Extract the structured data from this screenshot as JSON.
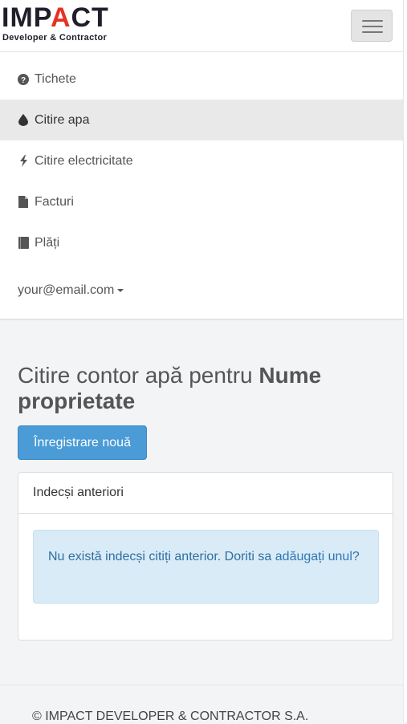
{
  "header": {
    "logo_main_prefix": "IMP",
    "logo_main_accent": "A",
    "logo_main_suffix": "CT",
    "logo_sub": "Developer & Contractor",
    "menu_toggle_icon": "hamburger-icon"
  },
  "menu": {
    "items": [
      {
        "label": "Tichete",
        "icon": "question-circle-icon",
        "active": false
      },
      {
        "label": "Citire apa",
        "icon": "water-drop-icon",
        "active": true
      },
      {
        "label": "Citire electricitate",
        "icon": "lightning-bolt-icon",
        "active": false
      },
      {
        "label": "Facturi",
        "icon": "file-icon",
        "active": false
      },
      {
        "label": "Plăți",
        "icon": "book-icon",
        "active": false
      }
    ],
    "user_email": "your@email.com"
  },
  "main": {
    "title_prefix": "Citire contor apă pentru ",
    "title_bold": "Nume proprietate",
    "new_button_label": "Înregistrare nouă",
    "panel_title": "Indecși anteriori",
    "alert_text": "Nu există indecși citiți anterior. Doriti sa ",
    "alert_link": "adăugați unul",
    "alert_suffix": "?"
  },
  "footer": {
    "text": "© IMPACT DEVELOPER & CONTRACTOR S.A."
  },
  "colors": {
    "accent": "#4a9bd6",
    "logo_red": "#e53222",
    "alert_bg": "#d9ebf7"
  }
}
